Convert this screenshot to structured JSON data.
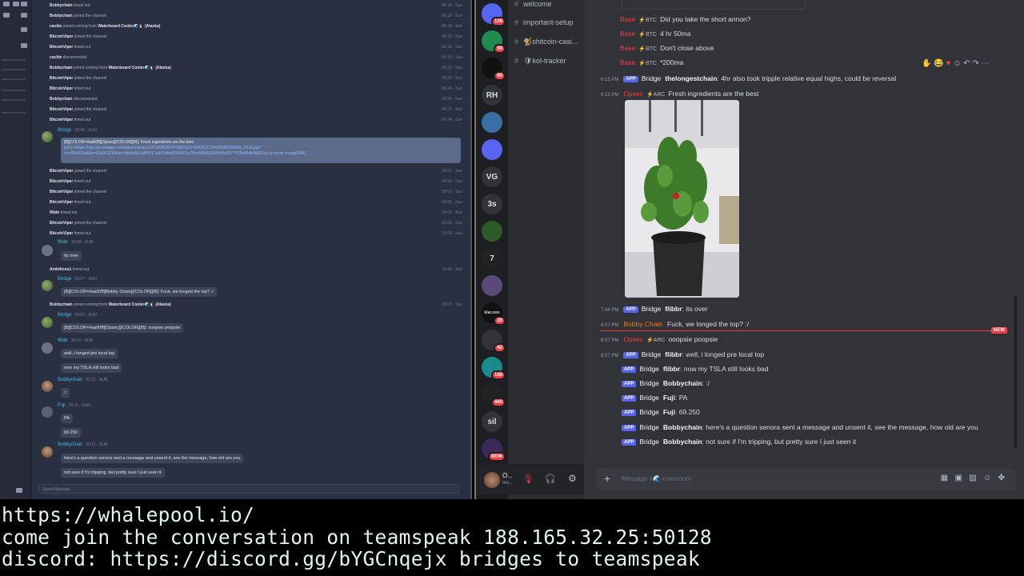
{
  "teamspeak": {
    "events": [
      {
        "name": "Bobbychain",
        "text": "timed out",
        "time": "06:18 - Sun"
      },
      {
        "name": "Bobbychain",
        "text": "joined the channel",
        "time": "06:18 - Sun"
      },
      {
        "name": "cackle",
        "text": "joined coming from",
        "extra": "Waterboard Cooler🌊🐧 (Alaska)",
        "time": "06:18 - Sun"
      },
      {
        "name": "BitcoinViper",
        "text": "joined the channel",
        "time": "06:19 - Sun"
      },
      {
        "name": "BitcoinViper",
        "text": "timed out",
        "time": "06:19 - Sun"
      },
      {
        "name": "cackle",
        "text": "disconnected",
        "time": "06:19 - Sun"
      },
      {
        "name": "Bobbychain",
        "text": "joined coming from",
        "extra": "Waterboard Cooler🌊🐧 (Alaska)",
        "time": "06:19 - Sun"
      },
      {
        "name": "BitcoinViper",
        "text": "joined the channel",
        "time": "06:20 - Sun"
      },
      {
        "name": "BitcoinViper",
        "text": "timed out",
        "time": "06:24 - Sun"
      },
      {
        "name": "Bobbychain",
        "text": "disconnected",
        "time": "06:24 - Sun"
      },
      {
        "name": "BitcoinViper",
        "text": "joined the channel",
        "time": "06:24 - Sun"
      },
      {
        "name": "BitcoinViper",
        "text": "timed out",
        "time": "06:24 - Sun"
      }
    ],
    "bridge_post": {
      "user": "Bridge",
      "time": "18:45 - SUN",
      "line1": "[B][COLOR=#aa00ff][Opsec][/COLOR][/B]: Fresh ingredients are the best",
      "line2": "[URL=https://cdn.discordapp.com/attachments/1137944828747988033/1409051273444585660/IMG_0318.jpg?",
      "line3": "ex=69d453a8&is=69d30228&hm=dfdda6b1a8f4517a4f7a8cd8306421c75bafd5861056fcf9c6577f7f2b464b5f&]Click to show image[/URL]"
    },
    "events2": [
      {
        "name": "BitcoinViper",
        "text": "joined the channel",
        "time": "18:51 - Sun"
      },
      {
        "name": "BitcoinViper",
        "text": "timed out",
        "time": "18:52 - Sun"
      },
      {
        "name": "BitcoinViper",
        "text": "joined the channel",
        "time": "18:53 - Sun"
      },
      {
        "name": "BitcoinViper",
        "text": "timed out",
        "time": "18:55 - Sun"
      },
      {
        "name": "flibbr",
        "text": "timed out",
        "time": "19:02 - Sun"
      },
      {
        "name": "BitcoinViper",
        "text": "joined the channel",
        "time": "19:05 - Sun"
      },
      {
        "name": "BitcoinViper",
        "text": "timed out",
        "time": "19:09 - Sun"
      }
    ],
    "flibbr_post": {
      "user": "flibbr",
      "time": "19:44 - SUN",
      "msg": "its over"
    },
    "ambitions": {
      "name": "Ambitions1",
      "text": "timed out",
      "time": "19:46 - Sun"
    },
    "bridge2": {
      "user": "Bridge",
      "time": "20:07 - SUN",
      "msg": "[B][COLOR=#aa00ff][Bobby Chain][/COLOR][/B]: Fuck, we longed the top? :/"
    },
    "bobby_join": {
      "name": "Bobbychain",
      "text": "joined coming from",
      "extra": "Waterboard Cooler🌊🐧 (Alaska)",
      "time": "20:07 - Sun"
    },
    "bridge3": {
      "user": "Bridge",
      "time": "20:07 - SUN",
      "msg": "[B][COLOR=#aa00ff][Opsec][/COLOR][/B]: ooopsie poopsie"
    },
    "flibbr2": {
      "user": "flibbr",
      "time": "20:07 - SUN",
      "msg1": "well, i longed pre local top",
      "msg2": "now my TSLA still looks bad"
    },
    "bobby2": {
      "user": "Bobbychain",
      "time": "20:11 - SUN",
      "msg": ":/"
    },
    "fuji": {
      "user": "Fuji",
      "time": "20:11 - SUN",
      "msg1": "PA",
      "msg2": "69.250"
    },
    "bobby3": {
      "user": "Bobbychain",
      "time": "20:11 - SUN",
      "msg1": "here's a question senora sent a message and unsent it, see the message, how old are you",
      "msg2": "not sure if I'm tripping, but pretty sure I just seen it"
    },
    "input_placeholder": "Send Message"
  },
  "discord": {
    "guilds": [
      {
        "label": "",
        "badge": "138"
      },
      {
        "label": "",
        "badge": "98"
      },
      {
        "label": "",
        "badge": "90"
      },
      {
        "label": "RH",
        "badge": ""
      },
      {
        "label": "",
        "badge": ""
      },
      {
        "label": "",
        "badge": ""
      },
      {
        "label": "VG",
        "badge": ""
      },
      {
        "label": "3s",
        "badge": ""
      },
      {
        "label": "",
        "badge": ""
      },
      {
        "label": "7",
        "badge": ""
      },
      {
        "label": "",
        "badge": ""
      },
      {
        "label": "klar.ooo",
        "badge": "29"
      },
      {
        "label": "",
        "badge": "42"
      },
      {
        "label": "",
        "badge": "148"
      },
      {
        "label": "",
        "badge": "446"
      },
      {
        "label": "sil",
        "badge": ""
      },
      {
        "label": "",
        "badge": "NEW"
      }
    ],
    "channels": [
      "welcome",
      "important-setup",
      "🐒shitcoin-casi...",
      "🛡kol-tracker"
    ],
    "messages": {
      "m1": {
        "name": "Base",
        "tag": "⚡BTC",
        "text": "Did you take the short annon?"
      },
      "m2": {
        "name": "Base",
        "tag": "⚡BTC",
        "text": "4 hr 50ma"
      },
      "m3": {
        "name": "Base",
        "tag": "⚡BTC",
        "text": "Don't close above"
      },
      "m4": {
        "name": "Base",
        "tag": "⚡BTC",
        "text": "*200ma"
      },
      "m5": {
        "time": "6:15 PM",
        "app": "APP",
        "bridge": "Bridge",
        "nick": "thelongestchain",
        "text": ": 4hr also took tripple relative equal highs, could be reversal"
      },
      "m6": {
        "time": "6:15 PM",
        "name": "Opsec",
        "tag": "⚡ARC",
        "text": "Fresh ingredients are the best"
      },
      "m7": {
        "time": "7:44 PM",
        "app": "APP",
        "bridge": "Bridge",
        "nick": "flibbr",
        "text": ": its over"
      },
      "m8": {
        "time": "8:07 PM",
        "name": "Bobby Chain",
        "text": "Fuck, we longed the top? :/"
      },
      "m9": {
        "time": "8:07 PM",
        "name": "Opsec",
        "tag": "⚡ARC",
        "text": "ooopsie poopsie"
      },
      "m10": {
        "time": "8:07 PM",
        "app": "APP",
        "bridge": "Bridge",
        "nick": "flibbr",
        "text": ": well, i longed pre local top"
      },
      "m11": {
        "app": "APP",
        "bridge": "Bridge",
        "nick": "flibbr",
        "text": ": now my TSLA still looks bad"
      },
      "m12": {
        "app": "APP",
        "bridge": "Bridge",
        "nick": "Bobbychain",
        "text": ": :/"
      },
      "m13": {
        "app": "APP",
        "bridge": "Bridge",
        "nick": "Fuji",
        "text": ": PA"
      },
      "m14": {
        "app": "APP",
        "bridge": "Bridge",
        "nick": "Fuji",
        "text": ": 69.250"
      },
      "m15": {
        "app": "APP",
        "bridge": "Bridge",
        "nick": "Bobbychain",
        "text": ": here's a question senora sent a message and unsent it, see the message, how old are you"
      },
      "m16": {
        "app": "APP",
        "bridge": "Bridge",
        "nick": "Bobbychain",
        "text": ": not sure if I'm tripping, but pretty sure I just seen it"
      }
    },
    "new_label": "NEW",
    "input_placeholder": "Message #🌊-mainroom",
    "user": {
      "name": "O...",
      "status": "Inv..."
    }
  },
  "banner": {
    "line1": "https://whalepool.io/",
    "line2": "come join the conversation on teamspeak 188.165.32.25:50128",
    "line3": "discord: https://discord.gg/bYGCnqejx bridges to teamspeak"
  },
  "colors": {
    "discord_bg": "#313338",
    "ts_bg": "#283041",
    "blurple": "#5865f2",
    "mention_red": "#f23f43"
  }
}
